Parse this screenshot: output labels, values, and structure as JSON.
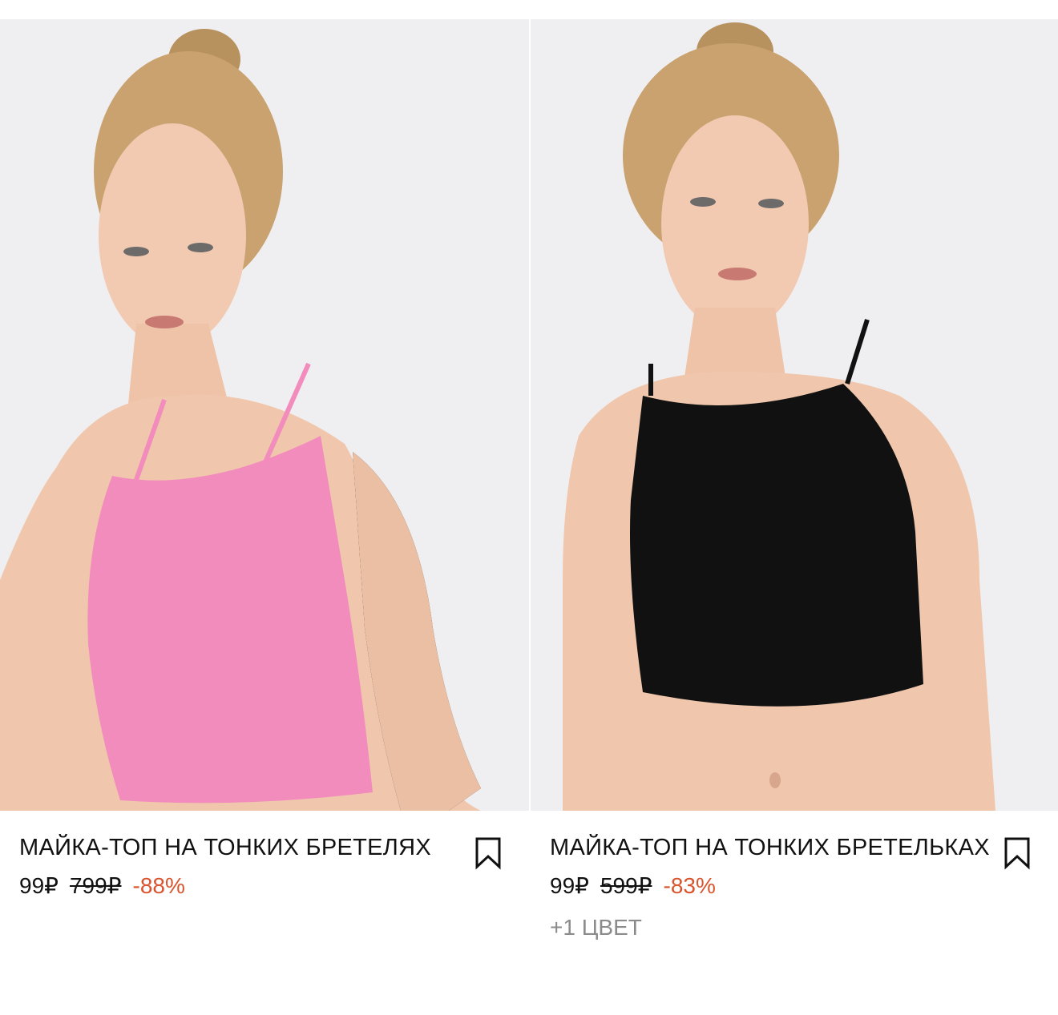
{
  "products": [
    {
      "title": "МАЙКА-ТОП НА ТОНКИХ БРЕТЕЛЯХ",
      "price_current": "99₽",
      "price_old": "799₽",
      "discount": "-88%",
      "garment_color": "#f28cbc",
      "image_alt": "model-in-pink-crop-top"
    },
    {
      "title": "МАЙКА-ТОП НА ТОНКИХ БРЕТЕЛЬКАХ",
      "price_current": "99₽",
      "price_old": "599₽",
      "discount": "-83%",
      "colors_more": "+1 ЦВЕТ",
      "garment_color": "#111111",
      "image_alt": "model-in-black-crop-top"
    }
  ],
  "colors": {
    "discount": "#d9532c",
    "muted": "#8b8b8b",
    "text": "#111111"
  }
}
